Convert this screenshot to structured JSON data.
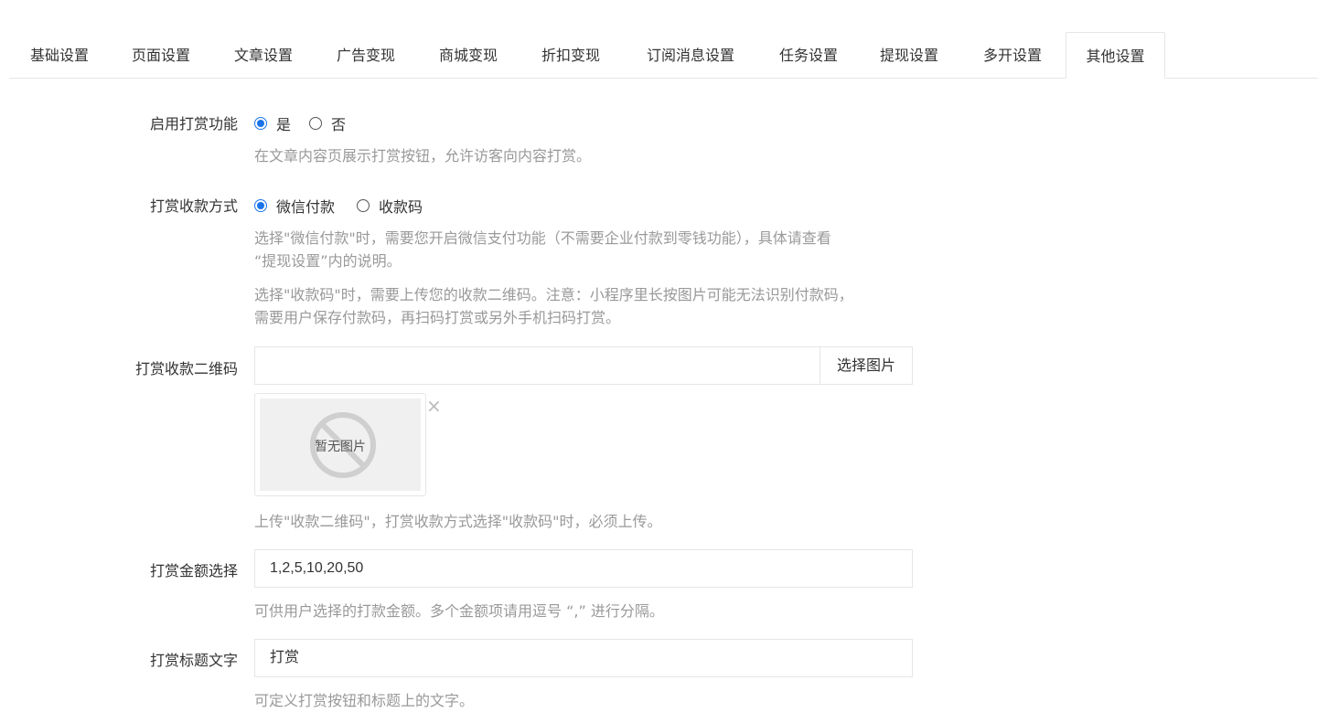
{
  "tabs": [
    {
      "label": "基础设置",
      "active": false
    },
    {
      "label": "页面设置",
      "active": false
    },
    {
      "label": "文章设置",
      "active": false
    },
    {
      "label": "广告变现",
      "active": false
    },
    {
      "label": "商城变现",
      "active": false
    },
    {
      "label": "折扣变现",
      "active": false
    },
    {
      "label": "订阅消息设置",
      "active": false
    },
    {
      "label": "任务设置",
      "active": false
    },
    {
      "label": "提现设置",
      "active": false
    },
    {
      "label": "多开设置",
      "active": false
    },
    {
      "label": "其他设置",
      "active": true
    }
  ],
  "reward_enable": {
    "label": "启用打赏功能",
    "options": [
      {
        "label": "是",
        "checked": true
      },
      {
        "label": "否",
        "checked": false
      }
    ],
    "help": "在文章内容页展示打赏按钮，允许访客向内容打赏。"
  },
  "reward_method": {
    "label": "打赏收款方式",
    "options": [
      {
        "label": "微信付款",
        "checked": true
      },
      {
        "label": "收款码",
        "checked": false
      }
    ],
    "help1_line1": "选择\"微信付款\"时，需要您开启微信支付功能（不需要企业付款到零钱功能），具体请查看",
    "help1_line2": "“提现设置”内的说明。",
    "help2_line1": "选择\"收款码\"时，需要上传您的收款二维码。注意：小程序里长按图片可能无法识别付款码，",
    "help2_line2": "需要用户保存付款码，再扫码打赏或另外手机扫码打赏。"
  },
  "reward_qrcode": {
    "label": "打赏收款二维码",
    "value": "",
    "pick_button": "选择图片",
    "placeholder_text": "暂无图片",
    "remove": "×",
    "help": "上传\"收款二维码\"，打赏收款方式选择\"收款码\"时，必须上传。"
  },
  "reward_amounts": {
    "label": "打赏金额选择",
    "value": "1,2,5,10,20,50",
    "help": "可供用户选择的打款金额。多个金额项请用逗号 “,” 进行分隔。"
  },
  "reward_title": {
    "label": "打赏标题文字",
    "value": "打赏",
    "help": "可定义打赏按钮和标题上的文字。"
  },
  "colors": {
    "accent": "#1a73e8",
    "border": "#e6e6e6",
    "help_text": "#999999"
  }
}
